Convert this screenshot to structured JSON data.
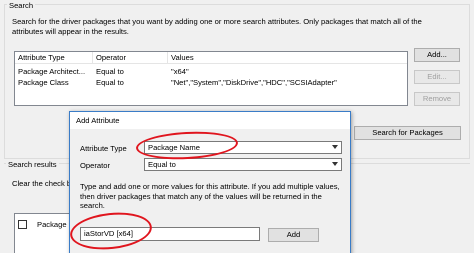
{
  "search_group": {
    "legend": "Search",
    "description": "Search for the driver packages that you want by adding one or more search attributes. Only packages that match all of the attributes will appear in the results.",
    "columns": [
      "Attribute Type",
      "Operator",
      "Values"
    ],
    "rows": [
      {
        "attribute": "Package Architect...",
        "operator": "Equal to",
        "values": "\"x64\""
      },
      {
        "attribute": "Package Class",
        "operator": "Equal to",
        "values": "\"Net\",\"System\",\"DiskDrive\",\"HDC\",\"SCSIAdapter\""
      }
    ],
    "buttons": {
      "add": "Add...",
      "edit": "Edit...",
      "remove": "Remove",
      "search": "Search for Packages"
    }
  },
  "results_group": {
    "legend": "Search results",
    "clear_text": "Clear the check b",
    "column_partial": "Package N"
  },
  "dialog": {
    "title": "Add Attribute",
    "attribute_type_label": "Attribute Type",
    "attribute_type_value": "Package Name",
    "operator_label": "Operator",
    "operator_value": "Equal to",
    "instructions": "Type and add one or more values for this attribute. If you add multiple values, then driver packages that match any of the values will be returned in the search.",
    "value_input": "iaStorVD [x64]",
    "add_button": "Add"
  },
  "colors": {
    "annotation": "#e0151e",
    "window_bg": "#f0f0f0",
    "dialog_border": "#3a7cc7"
  }
}
